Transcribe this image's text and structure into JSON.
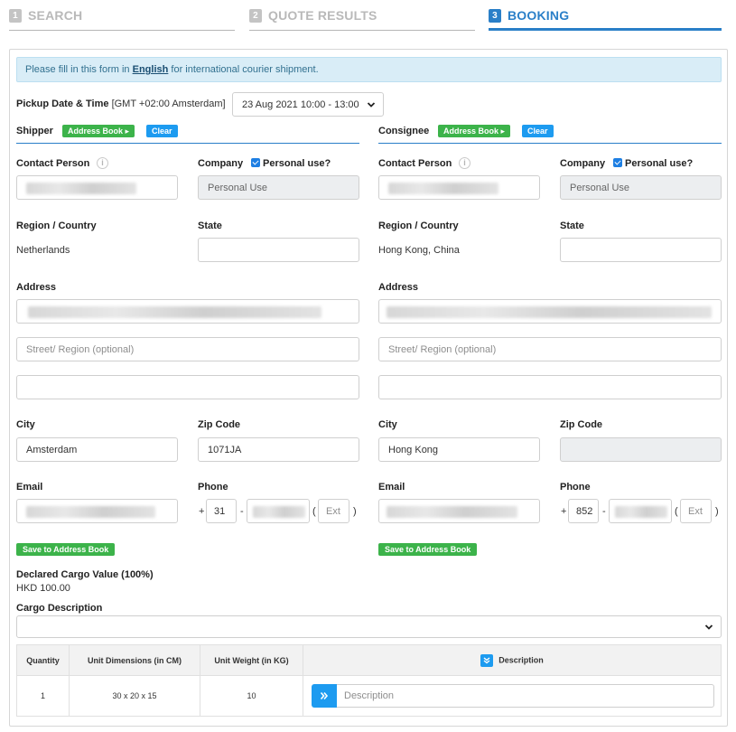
{
  "steps": [
    {
      "num": "1",
      "label": "SEARCH"
    },
    {
      "num": "2",
      "label": "QUOTE RESULTS"
    },
    {
      "num": "3",
      "label": "BOOKING"
    }
  ],
  "notice": {
    "pre": "Please fill in this form in ",
    "link": "English",
    "post": " for international courier shipment."
  },
  "pickup": {
    "label": "Pickup Date & Time",
    "timezone": "[GMT +02:00 Amsterdam]",
    "value": "23 Aug 2021 10:00 - 13:00"
  },
  "shipper": {
    "title": "Shipper",
    "address_book": "Address Book",
    "clear": "Clear",
    "contact_label": "Contact Person",
    "company_label": "Company",
    "personal_use_label": "Personal use?",
    "company_value": "Personal Use",
    "region_label": "Region / Country",
    "region_value": "Netherlands",
    "state_label": "State",
    "address_label": "Address",
    "street_placeholder": "Street/ Region (optional)",
    "city_label": "City",
    "city_value": "Amsterdam",
    "zip_label": "Zip Code",
    "zip_value": "1071JA",
    "email_label": "Email",
    "phone_label": "Phone",
    "phone_plus": "+",
    "phone_code": "31",
    "phone_dash": "-",
    "ext_open": "(",
    "ext_placeholder": "Ext",
    "ext_close": ")",
    "save_label": "Save to Address Book"
  },
  "consignee": {
    "title": "Consignee",
    "address_book": "Address Book",
    "clear": "Clear",
    "contact_label": "Contact Person",
    "company_label": "Company",
    "personal_use_label": "Personal use?",
    "company_value": "Personal Use",
    "region_label": "Region / Country",
    "region_value": "Hong Kong, China",
    "state_label": "State",
    "address_label": "Address",
    "street_placeholder": "Street/ Region (optional)",
    "city_label": "City",
    "city_value": "Hong Kong",
    "zip_label": "Zip Code",
    "email_label": "Email",
    "phone_label": "Phone",
    "phone_plus": "+",
    "phone_code": "852",
    "phone_dash": "-",
    "ext_open": "(",
    "ext_placeholder": "Ext",
    "ext_close": ")",
    "save_label": "Save to Address Book"
  },
  "declared": {
    "label": "Declared Cargo Value (100%)",
    "value": "HKD 100.00"
  },
  "cargo_description": {
    "label": "Cargo Description",
    "value": ""
  },
  "cargo_table": {
    "headers": [
      "Quantity",
      "Unit Dimensions (in CM)",
      "Unit Weight (in KG)",
      "Description"
    ],
    "rows": [
      {
        "quantity": "1",
        "dimensions": "30 x 20 x 15",
        "weight": "10",
        "description_placeholder": "Description"
      }
    ]
  },
  "colors": {
    "accent": "#2a7fc8",
    "green": "#3cb34a",
    "blue_button": "#1d9bf0",
    "notice_bg": "#d9edf7"
  }
}
